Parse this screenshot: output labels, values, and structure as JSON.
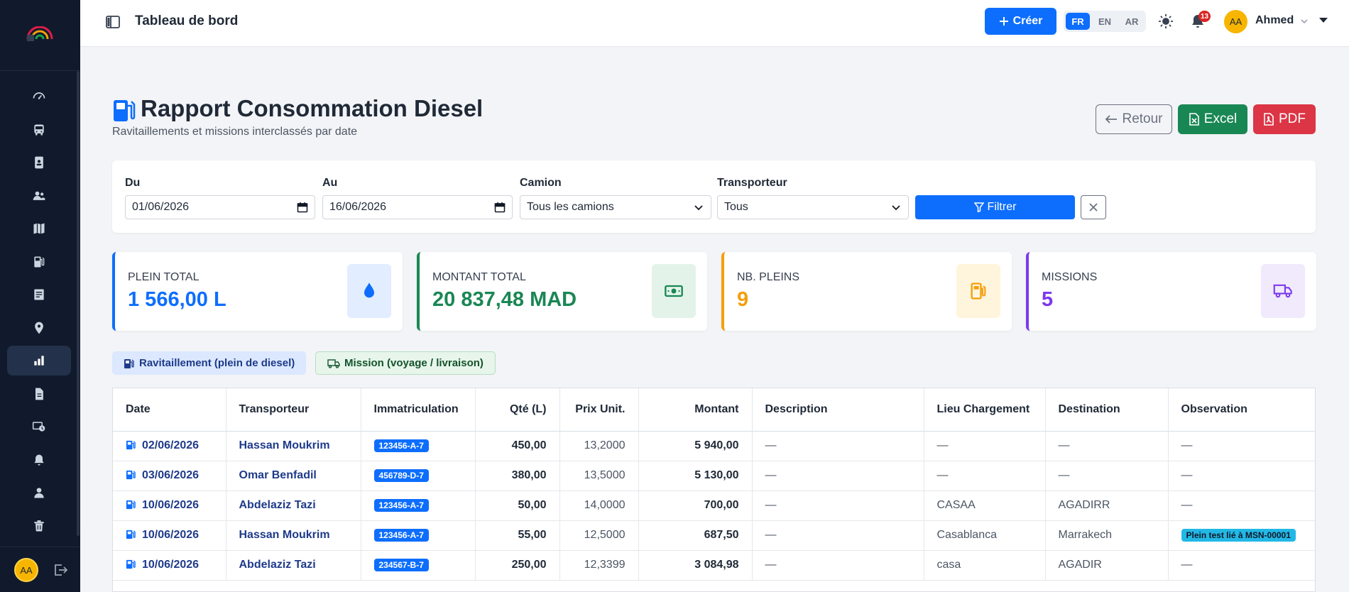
{
  "header": {
    "page_title": "Tableau de bord",
    "create_label": "Créer",
    "languages": [
      "FR",
      "EN",
      "AR"
    ],
    "active_language": "FR",
    "notification_count": "13",
    "user_initials": "AA",
    "user_name": "Ahmed"
  },
  "sidebar": {
    "items": [
      "dashboard-icon",
      "bus-icon",
      "id-card-icon",
      "users-icon",
      "map-icon",
      "fuel-pump-icon",
      "receipt-icon",
      "location-pin-icon",
      "chart-icon",
      "document-icon",
      "clock-cash-icon",
      "bell-icon",
      "person-icon",
      "trash-icon"
    ],
    "active_item": "chart-icon",
    "user_initials": "AA"
  },
  "report": {
    "title": "Rapport Consommation Diesel",
    "subtitle": "Ravitaillements et missions interclassés par date",
    "back_label": "Retour",
    "excel_label": "Excel",
    "pdf_label": "PDF"
  },
  "filters": {
    "from_label": "Du",
    "from_value": "01/06/2026",
    "to_label": "Au",
    "to_value": "16/06/2026",
    "truck_label": "Camion",
    "truck_value": "Tous les camions",
    "carrier_label": "Transporteur",
    "carrier_value": "Tous",
    "filter_label": "Filtrer"
  },
  "stats": [
    {
      "label": "PLEIN TOTAL",
      "value": "1 566,00 L",
      "color": "#0d6efd",
      "icon": "droplet-icon"
    },
    {
      "label": "MONTANT TOTAL",
      "value": "20 837,48 MAD",
      "color": "#198754",
      "icon": "cash-icon"
    },
    {
      "label": "NB. PLEINS",
      "value": "9",
      "color": "#f59e0b",
      "icon": "fuel-pump-icon"
    },
    {
      "label": "MISSIONS",
      "value": "5",
      "color": "#7c3aed",
      "icon": "truck-icon"
    }
  ],
  "legend": {
    "refuel_label": "Ravitaillement (plein de diesel)",
    "mission_label": "Mission (voyage / livraison)"
  },
  "table": {
    "headers": [
      "Date",
      "Transporteur",
      "Immatriculation",
      "Qté (L)",
      "Prix Unit.",
      "Montant",
      "Description",
      "Lieu Chargement",
      "Destination",
      "Observation"
    ],
    "rows": [
      {
        "date": "02/06/2026",
        "transporteur": "Hassan Moukrim",
        "immat": "123456-A-7",
        "qte": "450,00",
        "prix": "13,2000",
        "montant": "5 940,00",
        "description": "—",
        "lieu": "—",
        "destination": "—",
        "observation": "—"
      },
      {
        "date": "03/06/2026",
        "transporteur": "Omar Benfadil",
        "immat": "456789-D-7",
        "qte": "380,00",
        "prix": "13,5000",
        "montant": "5 130,00",
        "description": "—",
        "lieu": "—",
        "destination": "—",
        "observation": "—"
      },
      {
        "date": "10/06/2026",
        "transporteur": "Abdelaziz Tazi",
        "immat": "123456-A-7",
        "qte": "50,00",
        "prix": "14,0000",
        "montant": "700,00",
        "description": "—",
        "lieu": "CASAA",
        "destination": "AGADIRR",
        "observation": "—"
      },
      {
        "date": "10/06/2026",
        "transporteur": "Hassan Moukrim",
        "immat": "123456-A-7",
        "qte": "55,00",
        "prix": "12,5000",
        "montant": "687,50",
        "description": "—",
        "lieu": "Casablanca",
        "destination": "Marrakech",
        "observation": "Plein test lié à MSN-00001"
      },
      {
        "date": "10/06/2026",
        "transporteur": "Abdelaziz Tazi",
        "immat": "234567-B-7",
        "qte": "250,00",
        "prix": "12,3399",
        "montant": "3 084,98",
        "description": "—",
        "lieu": "casa",
        "destination": "AGADIR",
        "observation": "—"
      }
    ]
  }
}
